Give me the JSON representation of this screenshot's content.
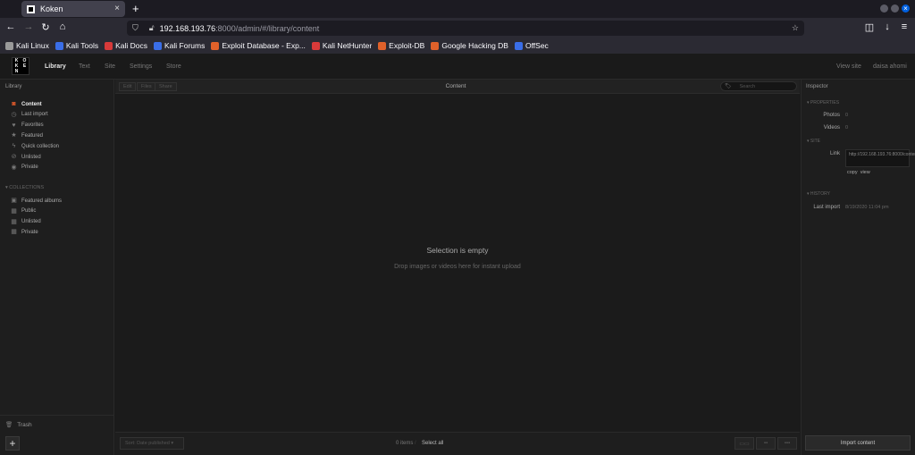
{
  "browser": {
    "tab_title": "Koken",
    "tab_close": "×",
    "new_tab": "+",
    "url_host": "192.168.193.76",
    "url_rest": ":8000/admin/#/library/content",
    "nav": {
      "back": "←",
      "forward": "→",
      "reload": "↻",
      "home": "⌂"
    },
    "right_icons": {
      "pocket": "◫",
      "download": "↓",
      "menu": "≡"
    },
    "bookmarks": [
      {
        "label": "Kali Linux",
        "color": "#9a9a9a"
      },
      {
        "label": "Kali Tools",
        "color": "#3a6ee8"
      },
      {
        "label": "Kali Docs",
        "color": "#d83a3a"
      },
      {
        "label": "Kali Forums",
        "color": "#3a6ee8"
      },
      {
        "label": "Exploit Database - Exp...",
        "color": "#e0612a"
      },
      {
        "label": "Kali NetHunter",
        "color": "#d83a3a"
      },
      {
        "label": "Exploit-DB",
        "color": "#e0612a"
      },
      {
        "label": "Google Hacking DB",
        "color": "#e0612a"
      },
      {
        "label": "OffSec",
        "color": "#3a6ee8"
      }
    ]
  },
  "app": {
    "logo": [
      "K",
      "O",
      "K",
      "E",
      "N",
      ""
    ],
    "nav": [
      "Library",
      "Text",
      "Site",
      "Settings",
      "Store"
    ],
    "right_links": {
      "view_site": "View site",
      "user": "daisa ahomi"
    },
    "accent": "#e05a2b"
  },
  "sidebar": {
    "title": "Library",
    "items": [
      {
        "label": "Content",
        "icon": "camera-icon",
        "glyph": "◙"
      },
      {
        "label": "Last import",
        "icon": "clock-icon",
        "glyph": "◷"
      },
      {
        "label": "Favorites",
        "icon": "heart-icon",
        "glyph": "♥"
      },
      {
        "label": "Featured",
        "icon": "star-icon",
        "glyph": "★"
      },
      {
        "label": "Quick collection",
        "icon": "bolt-icon",
        "glyph": "ϟ"
      },
      {
        "label": "Unlisted",
        "icon": "eye-slash-icon",
        "glyph": "⊘"
      },
      {
        "label": "Private",
        "icon": "lock-icon",
        "glyph": "◉"
      }
    ],
    "collections_title": "COLLECTIONS",
    "collections": [
      {
        "label": "Featured albums",
        "icon": "album-icon",
        "glyph": "▣"
      },
      {
        "label": "Public",
        "icon": "album-icon",
        "glyph": "▦"
      },
      {
        "label": "Unlisted",
        "icon": "album-icon",
        "glyph": "▦"
      },
      {
        "label": "Private",
        "icon": "album-icon",
        "glyph": "▦"
      }
    ],
    "trash": "Trash",
    "add": "+"
  },
  "content": {
    "toolbar_buttons": [
      "Edit",
      "Files",
      "Share"
    ],
    "title": "Content",
    "search_placeholder": "Search",
    "empty_title": "Selection is empty",
    "empty_subtitle": "Drop images or videos here for instant upload",
    "sort_label": "Sort: Date published ▾",
    "items_count": "0 items",
    "select_all": "Select all"
  },
  "inspector": {
    "title": "Inspector",
    "properties_title": "PROPERTIES",
    "photos_label": "Photos",
    "photos_value": "0",
    "videos_label": "Videos",
    "videos_value": "0",
    "site_title": "SITE",
    "link_label": "Link",
    "link_value": "http://192.168.193.76:8000/content/",
    "copy": "copy",
    "view": "view",
    "history_title": "HISTORY",
    "last_import_label": "Last import",
    "last_import_value": "8/19/2020 11:04 pm",
    "import_button": "Import content"
  }
}
